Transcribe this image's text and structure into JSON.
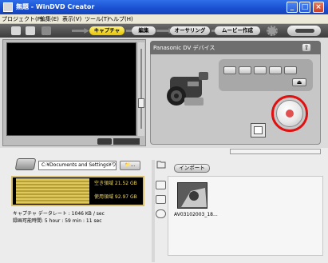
{
  "window": {
    "title": "無題 - WinDVD Creator",
    "controls": [
      "minimize",
      "maximize",
      "close"
    ]
  },
  "menu": {
    "items": [
      "プロジェクト(P)",
      "編集(E)",
      "表示(V)",
      "ツール(T)",
      "ヘルプ(H)"
    ]
  },
  "toolbar": {
    "tabs": [
      "キャプチャ",
      "編集",
      "オーサリング",
      "ムービー作成"
    ],
    "active_tab": "キャプチャ"
  },
  "device_panel": {
    "title": "Panasonic DV デバイス"
  },
  "storage": {
    "path": "C:¥Documents and Settings¥りんたろ...",
    "free_space": "空き領域 21.52 GB",
    "used_space": "使用領域 92.97 GB"
  },
  "capture_info": {
    "data_rate": "キャプチャ データレート : 1046 KB / sec",
    "recordable_time": "録画可能時間: 5 hour : 59 min : 11 sec"
  },
  "import": {
    "button_label": "インポート"
  },
  "media": {
    "clips": [
      {
        "name": "AV03102003_18..."
      }
    ]
  },
  "colors": {
    "accent_tab": "#f0d200",
    "record_ring": "#e01010",
    "record_dot": "#e05050",
    "titlebar": "#2a5ed8"
  }
}
